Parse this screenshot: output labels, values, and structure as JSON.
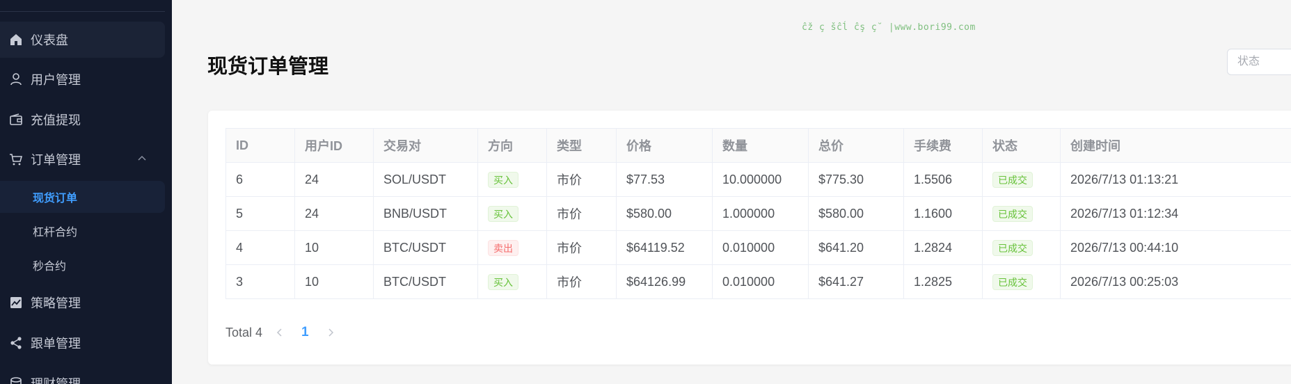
{
  "sidebar": {
    "items": [
      {
        "label": "仪表盘",
        "icon": "home-icon"
      },
      {
        "label": "用户管理",
        "icon": "user-icon"
      },
      {
        "label": "充值提现",
        "icon": "wallet-icon"
      },
      {
        "label": "订单管理",
        "icon": "cart-icon"
      },
      {
        "label": "策略管理",
        "icon": "chart-icon"
      },
      {
        "label": "跟单管理",
        "icon": "share-icon"
      },
      {
        "label": "理财管理",
        "icon": "database-icon"
      }
    ],
    "order_sub": [
      {
        "label": "现货订单"
      },
      {
        "label": "杠杆合约"
      },
      {
        "label": "秒合约"
      }
    ]
  },
  "header": {
    "title": "现货订单管理",
    "watermark": "ĉž ç šĉĺ ĉş ç˘ |www.bori99.com",
    "status_placeholder": "状态"
  },
  "table": {
    "columns": [
      "ID",
      "用户ID",
      "交易对",
      "方向",
      "类型",
      "价格",
      "数量",
      "总价",
      "手续费",
      "状态",
      "创建时间"
    ],
    "rows": [
      {
        "id": "6",
        "user_id": "24",
        "pair": "SOL/USDT",
        "side": "买入",
        "side_kind": "buy",
        "type": "市价",
        "price": "$77.53",
        "qty": "10.000000",
        "total": "$775.30",
        "fee": "1.5506",
        "status": "已成交",
        "created": "2026/7/13 01:13:21"
      },
      {
        "id": "5",
        "user_id": "24",
        "pair": "BNB/USDT",
        "side": "买入",
        "side_kind": "buy",
        "type": "市价",
        "price": "$580.00",
        "qty": "1.000000",
        "total": "$580.00",
        "fee": "1.1600",
        "status": "已成交",
        "created": "2026/7/13 01:12:34"
      },
      {
        "id": "4",
        "user_id": "10",
        "pair": "BTC/USDT",
        "side": "卖出",
        "side_kind": "sell",
        "type": "市价",
        "price": "$64119.52",
        "qty": "0.010000",
        "total": "$641.20",
        "fee": "1.2824",
        "status": "已成交",
        "created": "2026/7/13 00:44:10"
      },
      {
        "id": "3",
        "user_id": "10",
        "pair": "BTC/USDT",
        "side": "买入",
        "side_kind": "buy",
        "type": "市价",
        "price": "$64126.99",
        "qty": "0.010000",
        "total": "$641.27",
        "fee": "1.2825",
        "status": "已成交",
        "created": "2026/7/13 00:25:03"
      }
    ]
  },
  "pagination": {
    "total_label": "Total 4",
    "current_page": "1"
  },
  "colors": {
    "sidebar_bg": "#131a2c",
    "accent": "#409eff",
    "buy": "#67c23a",
    "sell": "#f56c6c"
  }
}
